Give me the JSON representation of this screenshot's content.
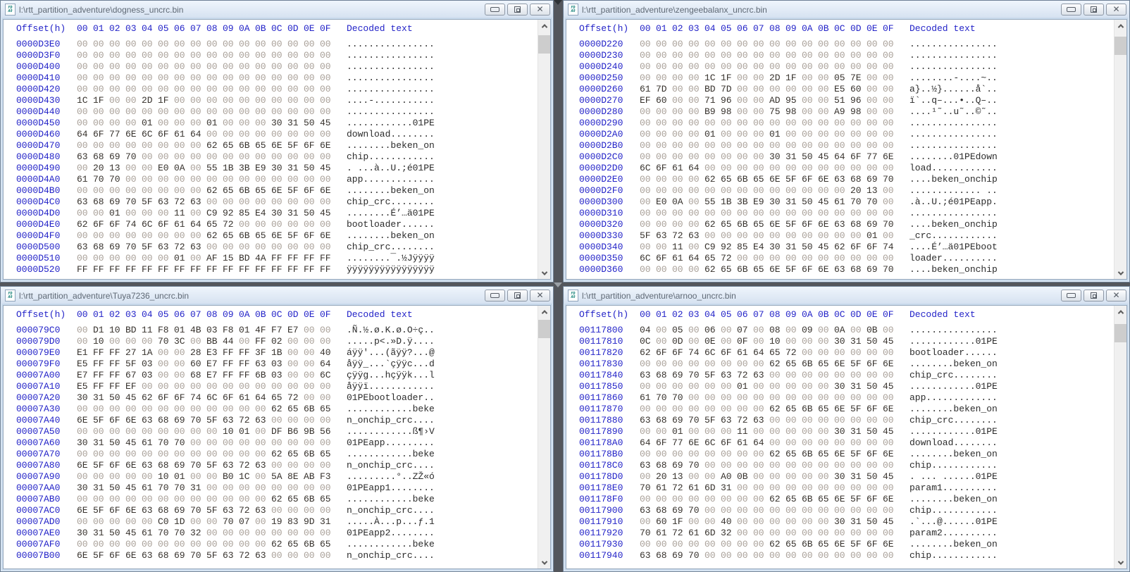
{
  "app": "hex-editor",
  "colors": {
    "offset_blue": "#2323c8",
    "byte_nonzero": "#37322d",
    "byte_zero_gray": "#a89f97",
    "decoded_text": "#2b2b2b",
    "titlebar_text": "#5f6975",
    "file_icon_teal": "#0e7d74",
    "window_frame": "#c9daec",
    "scroll_track": "#f0f0f0",
    "scroll_thumb": "#cdcdcd"
  },
  "header": {
    "offset_label": "Offset(h)",
    "byte_labels": [
      "00",
      "01",
      "02",
      "03",
      "04",
      "05",
      "06",
      "07",
      "08",
      "09",
      "0A",
      "0B",
      "0C",
      "0D",
      "0E",
      "0F"
    ],
    "decoded_label": "Decoded text"
  },
  "file_icon_text": {
    "line1": "FD",
    "line2": "A0"
  },
  "windows": [
    {
      "title": "l:\\rtt_partition_adventure\\dogness_uncrc.bin",
      "rows": [
        {
          "offset": "0000D3E0",
          "bytes": "00 00 00 00 00 00 00 00 00 00 00 00 00 00 00 00",
          "decoded": "................"
        },
        {
          "offset": "0000D3F0",
          "bytes": "00 00 00 00 00 00 00 00 00 00 00 00 00 00 00 00",
          "decoded": "................"
        },
        {
          "offset": "0000D400",
          "bytes": "00 00 00 00 00 00 00 00 00 00 00 00 00 00 00 00",
          "decoded": "................"
        },
        {
          "offset": "0000D410",
          "bytes": "00 00 00 00 00 00 00 00 00 00 00 00 00 00 00 00",
          "decoded": "................"
        },
        {
          "offset": "0000D420",
          "bytes": "00 00 00 00 00 00 00 00 00 00 00 00 00 00 00 00",
          "decoded": "................"
        },
        {
          "offset": "0000D430",
          "bytes": "1C 1F 00 00 2D 1F 00 00 00 00 00 00 00 00 00 00",
          "decoded": "....-..........."
        },
        {
          "offset": "0000D440",
          "bytes": "00 00 00 00 00 00 00 00 00 00 00 00 00 00 00 00",
          "decoded": "................"
        },
        {
          "offset": "0000D450",
          "bytes": "00 00 00 00 01 00 00 00 01 00 00 00 30 31 50 45",
          "decoded": "............01PE"
        },
        {
          "offset": "0000D460",
          "bytes": "64 6F 77 6E 6C 6F 61 64 00 00 00 00 00 00 00 00",
          "decoded": "download........"
        },
        {
          "offset": "0000D470",
          "bytes": "00 00 00 00 00 00 00 00 62 65 6B 65 6E 5F 6F 6E",
          "decoded": "........beken_on"
        },
        {
          "offset": "0000D480",
          "bytes": "63 68 69 70 00 00 00 00 00 00 00 00 00 00 00 00",
          "decoded": "chip............"
        },
        {
          "offset": "0000D490",
          "bytes": "00 20 13 00 00 E0 0A 00 55 1B 3B E9 30 31 50 45",
          "decoded": ". ...à..U.;é01PE"
        },
        {
          "offset": "0000D4A0",
          "bytes": "61 70 70 00 00 00 00 00 00 00 00 00 00 00 00 00",
          "decoded": "app............."
        },
        {
          "offset": "0000D4B0",
          "bytes": "00 00 00 00 00 00 00 00 62 65 6B 65 6E 5F 6F 6E",
          "decoded": "........beken_on"
        },
        {
          "offset": "0000D4C0",
          "bytes": "63 68 69 70 5F 63 72 63 00 00 00 00 00 00 00 00",
          "decoded": "chip_crc........"
        },
        {
          "offset": "0000D4D0",
          "bytes": "00 00 01 00 00 00 11 00 C9 92 85 E4 30 31 50 45",
          "decoded": "........É’…ä01PE"
        },
        {
          "offset": "0000D4E0",
          "bytes": "62 6F 6F 74 6C 6F 61 64 65 72 00 00 00 00 00 00",
          "decoded": "bootloader......"
        },
        {
          "offset": "0000D4F0",
          "bytes": "00 00 00 00 00 00 00 00 62 65 6B 65 6E 5F 6F 6E",
          "decoded": "........beken_on"
        },
        {
          "offset": "0000D500",
          "bytes": "63 68 69 70 5F 63 72 63 00 00 00 00 00 00 00 00",
          "decoded": "chip_crc........"
        },
        {
          "offset": "0000D510",
          "bytes": "00 00 00 00 00 00 01 00 AF 15 BD 4A FF FF FF FF",
          "decoded": "........¯.½Jÿÿÿÿ"
        },
        {
          "offset": "0000D520",
          "bytes": "FF FF FF FF FF FF FF FF FF FF FF FF FF FF FF FF",
          "decoded": "ÿÿÿÿÿÿÿÿÿÿÿÿÿÿÿÿ"
        }
      ]
    },
    {
      "title": "l:\\rtt_partition_adventure\\zengeebalanx_uncrc.bin",
      "rows": [
        {
          "offset": "0000D220",
          "bytes": "00 00 00 00 00 00 00 00 00 00 00 00 00 00 00 00",
          "decoded": "................"
        },
        {
          "offset": "0000D230",
          "bytes": "00 00 00 00 00 00 00 00 00 00 00 00 00 00 00 00",
          "decoded": "................"
        },
        {
          "offset": "0000D240",
          "bytes": "00 00 00 00 00 00 00 00 00 00 00 00 00 00 00 00",
          "decoded": "................"
        },
        {
          "offset": "0000D250",
          "bytes": "00 00 00 00 1C 1F 00 00 2D 1F 00 00 05 7E 00 00",
          "decoded": "........-....~.."
        },
        {
          "offset": "0000D260",
          "bytes": "61 7D 00 00 BD 7D 00 00 00 00 00 00 E5 60 00 00",
          "decoded": "a}..½}......å`.."
        },
        {
          "offset": "0000D270",
          "bytes": "EF 60 00 00 71 96 00 00 AD 95 00 00 51 96 00 00",
          "decoded": "ï`..q–...•..Q–.."
        },
        {
          "offset": "0000D280",
          "bytes": "00 00 00 00 B9 98 00 00 75 98 00 00 A9 98 00 00",
          "decoded": "....¹˜..u˜..©˜.."
        },
        {
          "offset": "0000D290",
          "bytes": "00 00 00 00 00 00 00 00 00 00 00 00 00 00 00 00",
          "decoded": "................"
        },
        {
          "offset": "0000D2A0",
          "bytes": "00 00 00 00 01 00 00 00 01 00 00 00 00 00 00 00",
          "decoded": "................"
        },
        {
          "offset": "0000D2B0",
          "bytes": "00 00 00 00 00 00 00 00 00 00 00 00 00 00 00 00",
          "decoded": "................"
        },
        {
          "offset": "0000D2C0",
          "bytes": "00 00 00 00 00 00 00 00 30 31 50 45 64 6F 77 6E",
          "decoded": "........01PEdown"
        },
        {
          "offset": "0000D2D0",
          "bytes": "6C 6F 61 64 00 00 00 00 00 00 00 00 00 00 00 00",
          "decoded": "load............"
        },
        {
          "offset": "0000D2E0",
          "bytes": "00 00 00 00 62 65 6B 65 6E 5F 6F 6E 63 68 69 70",
          "decoded": "....beken_onchip"
        },
        {
          "offset": "0000D2F0",
          "bytes": "00 00 00 00 00 00 00 00 00 00 00 00 00 20 13 00",
          "decoded": "............. .."
        },
        {
          "offset": "0000D300",
          "bytes": "00 E0 0A 00 55 1B 3B E9 30 31 50 45 61 70 70 00",
          "decoded": ".à..U.;é01PEapp."
        },
        {
          "offset": "0000D310",
          "bytes": "00 00 00 00 00 00 00 00 00 00 00 00 00 00 00 00",
          "decoded": "................"
        },
        {
          "offset": "0000D320",
          "bytes": "00 00 00 00 62 65 6B 65 6E 5F 6F 6E 63 68 69 70",
          "decoded": "....beken_onchip"
        },
        {
          "offset": "0000D330",
          "bytes": "5F 63 72 63 00 00 00 00 00 00 00 00 00 00 01 00",
          "decoded": "_crc............"
        },
        {
          "offset": "0000D340",
          "bytes": "00 00 11 00 C9 92 85 E4 30 31 50 45 62 6F 6F 74",
          "decoded": "....É’…ä01PEboot"
        },
        {
          "offset": "0000D350",
          "bytes": "6C 6F 61 64 65 72 00 00 00 00 00 00 00 00 00 00",
          "decoded": "loader.........."
        },
        {
          "offset": "0000D360",
          "bytes": "00 00 00 00 62 65 6B 65 6E 5F 6F 6E 63 68 69 70",
          "decoded": "....beken_onchip"
        }
      ]
    },
    {
      "title": "l:\\rtt_partition_adventure\\Tuya7236_uncrc.bin",
      "rows": [
        {
          "offset": "000079C0",
          "bytes": "00 D1 10 BD 11 F8 01 4B 03 F8 01 4F F7 E7 00 00",
          "decoded": ".Ñ.½.ø.K.ø.O÷ç.."
        },
        {
          "offset": "000079D0",
          "bytes": "00 10 00 00 00 70 3C 00 BB 44 00 FF 02 00 00 00",
          "decoded": ".....p<.»D.ÿ...."
        },
        {
          "offset": "000079E0",
          "bytes": "E1 FF FF 27 1A 00 00 28 E3 FF FF 3F 1B 00 00 40",
          "decoded": "áÿÿ'...(ãÿÿ?...@"
        },
        {
          "offset": "000079F0",
          "bytes": "E5 FF FF 5F 03 00 00 60 E7 FF FF 63 03 00 00 64",
          "decoded": "åÿÿ_...`çÿÿc...d"
        },
        {
          "offset": "00007A00",
          "bytes": "E7 FF FF 67 03 00 00 68 E7 FF FF 6B 03 00 00 6C",
          "decoded": "çÿÿg...hçÿÿk...l"
        },
        {
          "offset": "00007A10",
          "bytes": "E5 FF FF EF 00 00 00 00 00 00 00 00 00 00 00 00",
          "decoded": "åÿÿï............"
        },
        {
          "offset": "00007A20",
          "bytes": "30 31 50 45 62 6F 6F 74 6C 6F 61 64 65 72 00 00",
          "decoded": "01PEbootloader.."
        },
        {
          "offset": "00007A30",
          "bytes": "00 00 00 00 00 00 00 00 00 00 00 00 62 65 6B 65",
          "decoded": "............beke"
        },
        {
          "offset": "00007A40",
          "bytes": "6E 5F 6F 6E 63 68 69 70 5F 63 72 63 00 00 00 00",
          "decoded": "n_onchip_crc...."
        },
        {
          "offset": "00007A50",
          "bytes": "00 00 00 00 00 00 00 00 00 10 01 00 DF B6 9B 56",
          "decoded": "............ß¶›V"
        },
        {
          "offset": "00007A60",
          "bytes": "30 31 50 45 61 70 70 00 00 00 00 00 00 00 00 00",
          "decoded": "01PEapp........."
        },
        {
          "offset": "00007A70",
          "bytes": "00 00 00 00 00 00 00 00 00 00 00 00 62 65 6B 65",
          "decoded": "............beke"
        },
        {
          "offset": "00007A80",
          "bytes": "6E 5F 6F 6E 63 68 69 70 5F 63 72 63 00 00 00 00",
          "decoded": "n_onchip_crc...."
        },
        {
          "offset": "00007A90",
          "bytes": "00 00 00 00 00 10 01 00 00 B0 1C 00 5A 8E AB F3",
          "decoded": ".........°..ZŽ«ó"
        },
        {
          "offset": "00007AA0",
          "bytes": "30 31 50 45 61 70 70 31 00 00 00 00 00 00 00 00",
          "decoded": "01PEapp1........"
        },
        {
          "offset": "00007AB0",
          "bytes": "00 00 00 00 00 00 00 00 00 00 00 00 62 65 6B 65",
          "decoded": "............beke"
        },
        {
          "offset": "00007AC0",
          "bytes": "6E 5F 6F 6E 63 68 69 70 5F 63 72 63 00 00 00 00",
          "decoded": "n_onchip_crc...."
        },
        {
          "offset": "00007AD0",
          "bytes": "00 00 00 00 00 C0 1D 00 00 70 07 00 19 83 9D 31",
          "decoded": ".....À...p...ƒ.1"
        },
        {
          "offset": "00007AE0",
          "bytes": "30 31 50 45 61 70 70 32 00 00 00 00 00 00 00 00",
          "decoded": "01PEapp2........"
        },
        {
          "offset": "00007AF0",
          "bytes": "00 00 00 00 00 00 00 00 00 00 00 00 62 65 6B 65",
          "decoded": "............beke"
        },
        {
          "offset": "00007B00",
          "bytes": "6E 5F 6F 6E 63 68 69 70 5F 63 72 63 00 00 00 00",
          "decoded": "n_onchip_crc...."
        }
      ]
    },
    {
      "title": "l:\\rtt_partition_adventure\\arnoo_uncrc.bin",
      "rows": [
        {
          "offset": "00117800",
          "bytes": "04 00 05 00 06 00 07 00 08 00 09 00 0A 00 0B 00",
          "decoded": "................"
        },
        {
          "offset": "00117810",
          "bytes": "0C 00 0D 00 0E 00 0F 00 10 00 00 00 30 31 50 45",
          "decoded": "............01PE"
        },
        {
          "offset": "00117820",
          "bytes": "62 6F 6F 74 6C 6F 61 64 65 72 00 00 00 00 00 00",
          "decoded": "bootloader......"
        },
        {
          "offset": "00117830",
          "bytes": "00 00 00 00 00 00 00 00 62 65 6B 65 6E 5F 6F 6E",
          "decoded": "........beken_on"
        },
        {
          "offset": "00117840",
          "bytes": "63 68 69 70 5F 63 72 63 00 00 00 00 00 00 00 00",
          "decoded": "chip_crc........"
        },
        {
          "offset": "00117850",
          "bytes": "00 00 00 00 00 00 01 00 00 00 00 00 30 31 50 45",
          "decoded": "............01PE"
        },
        {
          "offset": "00117860",
          "bytes": "61 70 70 00 00 00 00 00 00 00 00 00 00 00 00 00",
          "decoded": "app............."
        },
        {
          "offset": "00117870",
          "bytes": "00 00 00 00 00 00 00 00 62 65 6B 65 6E 5F 6F 6E",
          "decoded": "........beken_on"
        },
        {
          "offset": "00117880",
          "bytes": "63 68 69 70 5F 63 72 63 00 00 00 00 00 00 00 00",
          "decoded": "chip_crc........"
        },
        {
          "offset": "00117890",
          "bytes": "00 00 01 00 00 00 11 00 00 00 00 00 30 31 50 45",
          "decoded": "............01PE"
        },
        {
          "offset": "001178A0",
          "bytes": "64 6F 77 6E 6C 6F 61 64 00 00 00 00 00 00 00 00",
          "decoded": "download........"
        },
        {
          "offset": "001178B0",
          "bytes": "00 00 00 00 00 00 00 00 62 65 6B 65 6E 5F 6F 6E",
          "decoded": "........beken_on"
        },
        {
          "offset": "001178C0",
          "bytes": "63 68 69 70 00 00 00 00 00 00 00 00 00 00 00 00",
          "decoded": "chip............"
        },
        {
          "offset": "001178D0",
          "bytes": "00 20 13 00 00 A0 0B 00 00 00 00 00 30 31 50 45",
          "decoded": ". ... ......01PE"
        },
        {
          "offset": "001178E0",
          "bytes": "70 61 72 61 6D 31 00 00 00 00 00 00 00 00 00 00",
          "decoded": "param1.........."
        },
        {
          "offset": "001178F0",
          "bytes": "00 00 00 00 00 00 00 00 62 65 6B 65 6E 5F 6F 6E",
          "decoded": "........beken_on"
        },
        {
          "offset": "00117900",
          "bytes": "63 68 69 70 00 00 00 00 00 00 00 00 00 00 00 00",
          "decoded": "chip............"
        },
        {
          "offset": "00117910",
          "bytes": "00 60 1F 00 00 40 00 00 00 00 00 00 30 31 50 45",
          "decoded": ".`...@......01PE"
        },
        {
          "offset": "00117920",
          "bytes": "70 61 72 61 6D 32 00 00 00 00 00 00 00 00 00 00",
          "decoded": "param2.........."
        },
        {
          "offset": "00117930",
          "bytes": "00 00 00 00 00 00 00 00 62 65 6B 65 6E 5F 6F 6E",
          "decoded": "........beken_on"
        },
        {
          "offset": "00117940",
          "bytes": "63 68 69 70 00 00 00 00 00 00 00 00 00 00 00 00",
          "decoded": "chip............"
        }
      ]
    }
  ]
}
